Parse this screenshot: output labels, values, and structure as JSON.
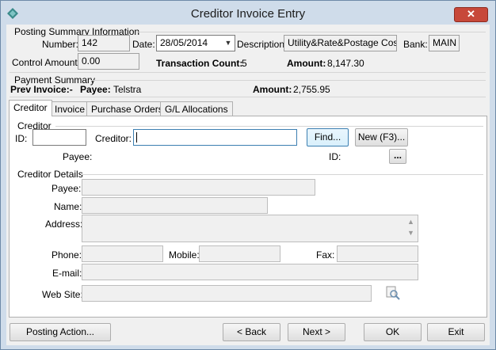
{
  "window": {
    "title": "Creditor Invoice Entry"
  },
  "posting_summary": {
    "heading": "Posting Summary Information",
    "number_label": "Number:",
    "number": "142",
    "date_label": "Date:",
    "date": "28/05/2014",
    "description_label": "Description:",
    "description": "Utility&Rate&Postage Costs",
    "bank_label": "Bank:",
    "bank": "MAIN",
    "control_amount_label": "Control Amount:",
    "control_amount": "0.00",
    "transaction_count_label": "Transaction Count:",
    "transaction_count": "5",
    "amount_label": "Amount:",
    "amount": "8,147.30"
  },
  "payment_summary": {
    "heading": "Payment Summary",
    "prev_invoice_label": "Prev Invoice:-",
    "payee_label": "Payee:",
    "payee": "Telstra",
    "amount_label": "Amount:",
    "amount": "2,755.95"
  },
  "tabs": [
    {
      "label": "Creditor"
    },
    {
      "label": "Invoice"
    },
    {
      "label": "Purchase Orders"
    },
    {
      "label": "G/L Allocations"
    }
  ],
  "creditor": {
    "heading": "Creditor",
    "id_label": "ID:",
    "id_value": "",
    "creditor_label": "Creditor:",
    "creditor_value": "",
    "find_button": "Find...",
    "new_button": "New (F3)...",
    "payee_label": "Payee:",
    "id2_label": "ID:",
    "browse_button": "..."
  },
  "creditor_details": {
    "heading": "Creditor Details",
    "payee_label": "Payee:",
    "payee": "",
    "name_label": "Name:",
    "name": "",
    "address_label": "Address:",
    "address": "",
    "phone_label": "Phone:",
    "phone": "",
    "mobile_label": "Mobile:",
    "mobile": "",
    "fax_label": "Fax:",
    "fax": "",
    "email_label": "E-mail:",
    "email": "",
    "website_label": "Web Site:",
    "website": ""
  },
  "footer": {
    "posting_action": "Posting Action...",
    "back": "< Back",
    "next": "Next >",
    "ok": "OK",
    "exit": "Exit"
  }
}
